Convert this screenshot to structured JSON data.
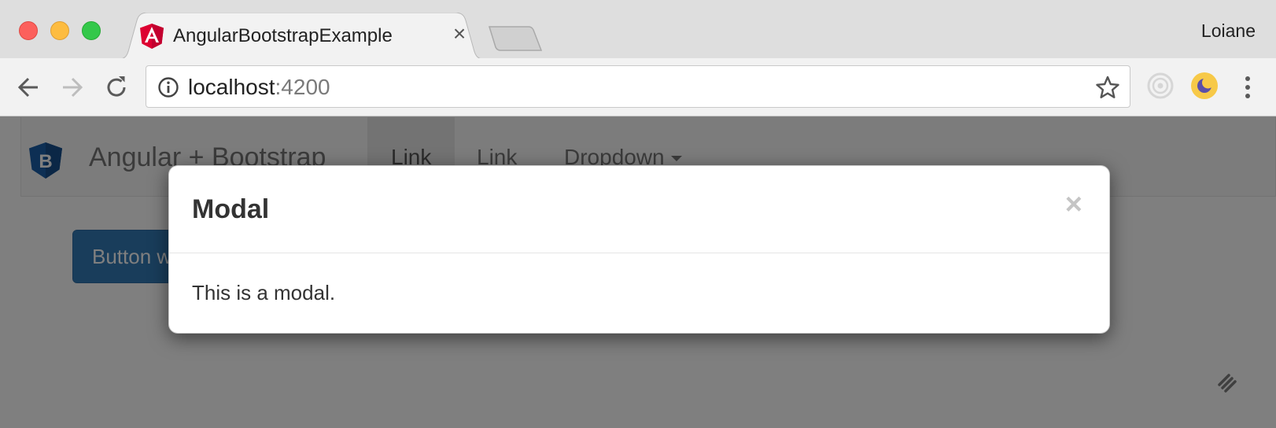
{
  "window": {
    "profile_name": "Loiane"
  },
  "tab": {
    "title": "AngularBootstrapExample",
    "close_glyph": "×",
    "favicon": "angular-icon"
  },
  "address_bar": {
    "host": "localhost",
    "port": ":4200"
  },
  "navbar": {
    "brand": "Angular + Bootstrap",
    "items": [
      {
        "label": "Link",
        "active": true
      },
      {
        "label": "Link",
        "active": false
      },
      {
        "label": "Dropdown",
        "active": false
      }
    ]
  },
  "page": {
    "button_label": "Button w"
  },
  "modal": {
    "title": "Modal",
    "close_glyph": "×",
    "body": "This is a modal."
  },
  "colors": {
    "primary": "#337ab7",
    "angular_red": "#dd0031",
    "bootstrap_blue": "#1a5fa8",
    "backdrop": "rgba(0,0,0,0.5)"
  }
}
